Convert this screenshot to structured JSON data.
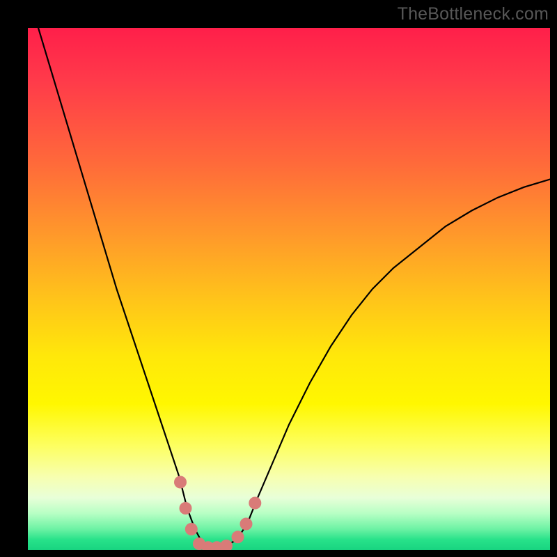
{
  "watermark": "TheBottleneck.com",
  "colors": {
    "background": "#000000",
    "curve": "#000000",
    "marker": "#d97b78",
    "gradient_top": "#ff1f4a",
    "gradient_bottom": "#18d480"
  },
  "chart_data": {
    "type": "line",
    "title": "",
    "xlabel": "",
    "ylabel": "",
    "xlim": [
      0,
      100
    ],
    "ylim": [
      0,
      100
    ],
    "note": "V-shaped bottleneck curve. y≈0 is best (bottom/green), y≈100 is worst (top/red). No axis ticks shown; values are estimated from pixel position.",
    "series": [
      {
        "name": "bottleneck-curve",
        "x": [
          2,
          5,
          8,
          11,
          14,
          17,
          20,
          23,
          26,
          29,
          30.5,
          32,
          33.5,
          35,
          36,
          38,
          40,
          42,
          44,
          47,
          50,
          54,
          58,
          62,
          66,
          70,
          75,
          80,
          85,
          90,
          95,
          100
        ],
        "y": [
          100,
          90,
          80,
          70,
          60,
          50,
          41,
          32,
          23,
          14,
          8,
          4,
          1.2,
          0.5,
          0.5,
          0.8,
          2,
          5,
          10,
          17,
          24,
          32,
          39,
          45,
          50,
          54,
          58,
          62,
          65,
          67.5,
          69.5,
          71
        ]
      }
    ],
    "markers": {
      "name": "highlighted-points",
      "x": [
        29.2,
        30.2,
        31.3,
        32.8,
        34.5,
        36.2,
        38.0,
        40.2,
        41.8,
        43.5
      ],
      "y": [
        13.0,
        8.0,
        4.0,
        1.2,
        0.5,
        0.5,
        0.8,
        2.5,
        5.0,
        9.0
      ]
    }
  }
}
